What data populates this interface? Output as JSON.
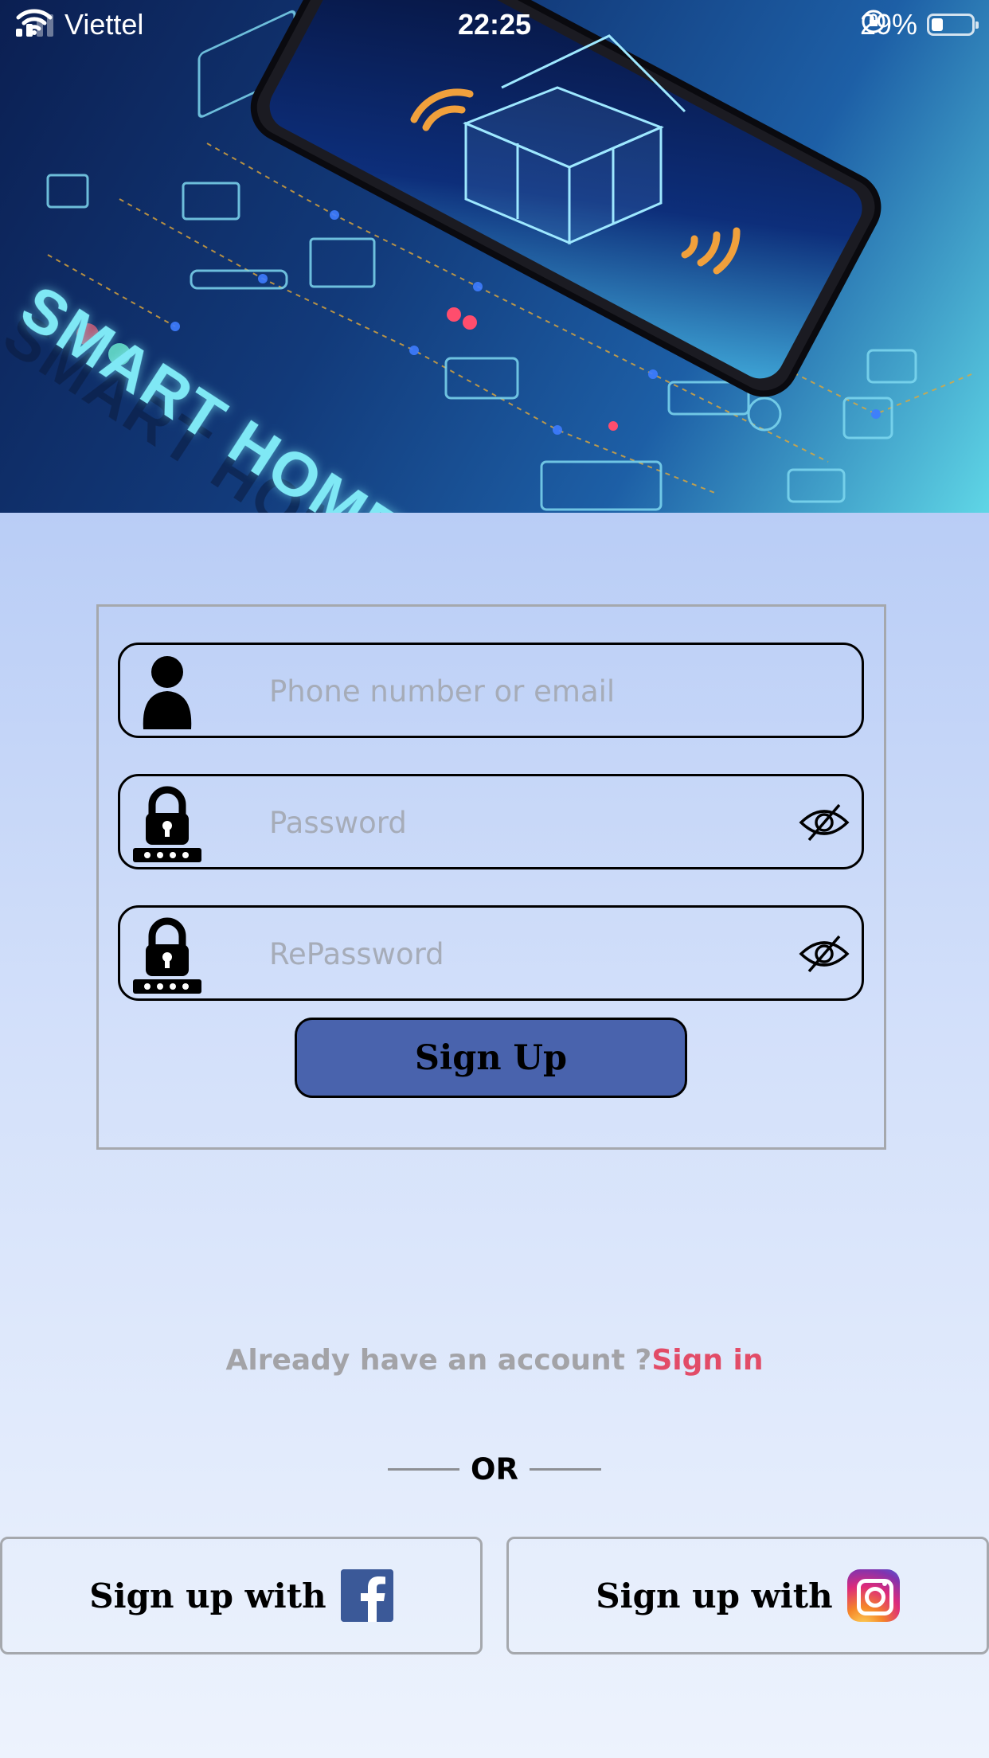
{
  "status_bar": {
    "carrier": "Viettel",
    "time": "22:25",
    "battery_percent": "29%",
    "battery_level": 0.29
  },
  "hero": {
    "title": "SMART HOME"
  },
  "form": {
    "phone_placeholder": "Phone number or email",
    "password_placeholder": "Password",
    "repassword_placeholder": "RePassword",
    "signup_label": "Sign Up"
  },
  "footer": {
    "question": "Already have an account ?",
    "signin_link": "Sign in",
    "or_label": "OR",
    "facebook_label": "Sign up with",
    "instagram_label": "Sign up with"
  },
  "colors": {
    "signup_button": "#4963ad",
    "signin_link": "#e24c68",
    "facebook": "#3b5998"
  },
  "icons": {
    "user": "user-icon",
    "lock": "lock-icon",
    "eye": "eye-slash-icon",
    "facebook": "facebook-icon",
    "instagram": "instagram-icon"
  }
}
